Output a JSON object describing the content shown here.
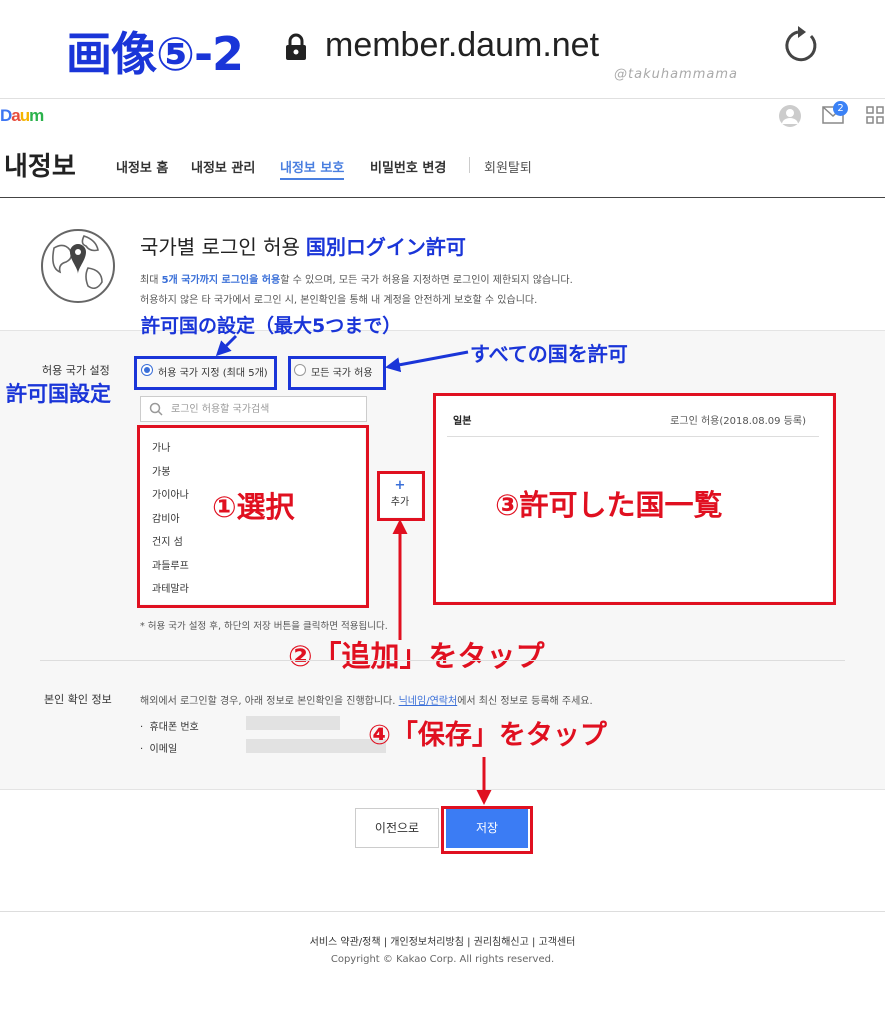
{
  "image_label": "画像⑤-2",
  "browser": {
    "url": "member.daum.net",
    "watermark": "@takuhammama"
  },
  "daum": {
    "logo": "Daum",
    "mail_badge": "2"
  },
  "header": {
    "title": "내정보",
    "nav": [
      "내정보 홈",
      "내정보 관리",
      "내정보 보호",
      "비밀번호 변경",
      "회원탈퇴"
    ],
    "active_nav": "내정보 보호"
  },
  "section": {
    "title": "국가별 로그인 허용",
    "title_jp": "国別ログイン許可",
    "desc1_pre": "최대 ",
    "desc1_hl": "5개 국가까지 로그인을 허용",
    "desc1_post": "할 수 있으며, 모든 국가 허용을 지정하면 로그인이 제한되지 않습니다.",
    "desc2": "허용하지 않은 타 국가에서 로그인 시, 본인확인을 통해 내 계정을 안전하게 보호할 수 있습니다."
  },
  "allow_setting": {
    "label": "허용 국가 설정",
    "label_jp": "許可国設定",
    "option_specific": "허용 국가 지정 (최대 5개)",
    "option_all": "모든 국가 허용",
    "note_specific_jp": "許可国の設定（最大5つまで）",
    "note_all_jp": "すべての国を許可",
    "search_placeholder": "로그인 허용할 국가검색",
    "countries": [
      "가나",
      "가봉",
      "가이아나",
      "감비아",
      "건지 섬",
      "과들루프",
      "과테말라"
    ],
    "note_select_jp": "①選択",
    "add_label": "추가",
    "note_add_jp": "②「追加」をタップ",
    "allowed": [
      {
        "name": "일본",
        "status": "로그인 허용(2018.08.09 등록)"
      }
    ],
    "note_list_jp": "③許可した国一覧",
    "footnote": "* 허용 국가 설정 후, 하단의 저장 버튼을 클릭하면 적용됩니다."
  },
  "identity": {
    "label": "본인 확인 정보",
    "desc_pre": "해외에서 로그인할 경우, 아래 정보로 본인확인을 진행합니다. ",
    "desc_link": "닉네임/연락처",
    "desc_post": "에서 최신 정보로 등록해 주세요.",
    "phone_label": "휴대폰 번호",
    "email_label": "이메일",
    "note_save_jp": "④「保存」をタップ"
  },
  "buttons": {
    "prev": "이전으로",
    "save": "저장"
  },
  "footer": {
    "links": "서비스 약관/정책 | 개인정보처리방침 | 권리침해신고 | 고객센터",
    "copyright": "Copyright © Kakao Corp. All rights reserved."
  },
  "colors": {
    "annotation_blue": "#1a35d8",
    "annotation_red": "#e01020",
    "link_blue": "#3a6fd8",
    "save_button": "#3b7cf4"
  }
}
